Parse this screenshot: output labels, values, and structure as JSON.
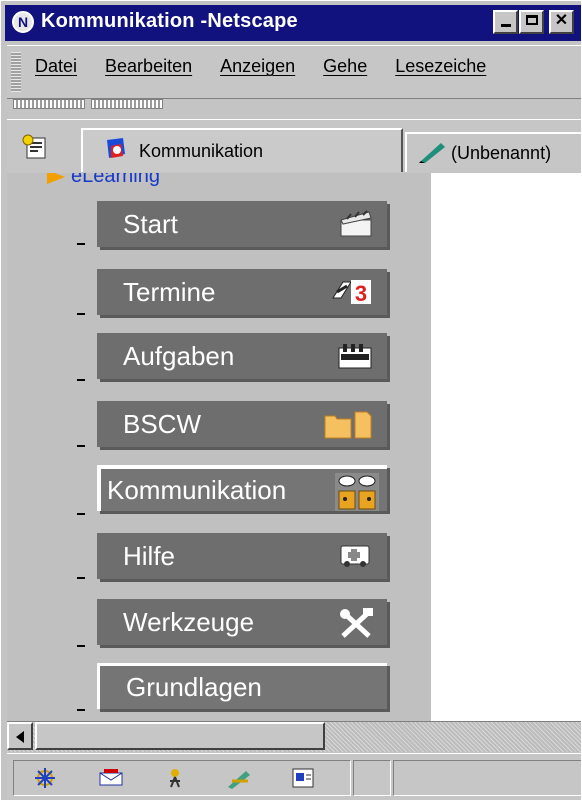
{
  "window": {
    "title": "Kommunikation -Netscape",
    "icon": "netscape-n-icon"
  },
  "menubar": {
    "items": [
      {
        "label": "Datei"
      },
      {
        "label": "Bearbeiten"
      },
      {
        "label": "Anzeigen"
      },
      {
        "label": "Gehe"
      },
      {
        "label": "Lesezeiche"
      }
    ]
  },
  "tabs": {
    "active_label": "Kommunikation",
    "other_label": "(Unbenannt)"
  },
  "sidebar": {
    "tree_label": "eLearning",
    "buttons": [
      {
        "label": "Start",
        "icon": "clapperboard-icon"
      },
      {
        "label": "Termine",
        "icon": "calendar-icon"
      },
      {
        "label": "Aufgaben",
        "icon": "factory-icon"
      },
      {
        "label": "BSCW",
        "icon": "folder-document-icon"
      },
      {
        "label": "Kommunikation",
        "icon": "speech-faces-icon",
        "selected": true
      },
      {
        "label": "Hilfe",
        "icon": "ambulance-icon"
      },
      {
        "label": "Werkzeuge",
        "icon": "tools-icon"
      },
      {
        "label": "Grundlagen",
        "icon": ""
      }
    ]
  },
  "statusbar": {
    "icons": [
      "navigator-icon",
      "mail-icon",
      "composer-icon",
      "edit-icon",
      "address-book-icon"
    ]
  },
  "colors": {
    "titlebar": "#12127e",
    "button_face": "#6e6e6e",
    "link": "#1838c8"
  }
}
